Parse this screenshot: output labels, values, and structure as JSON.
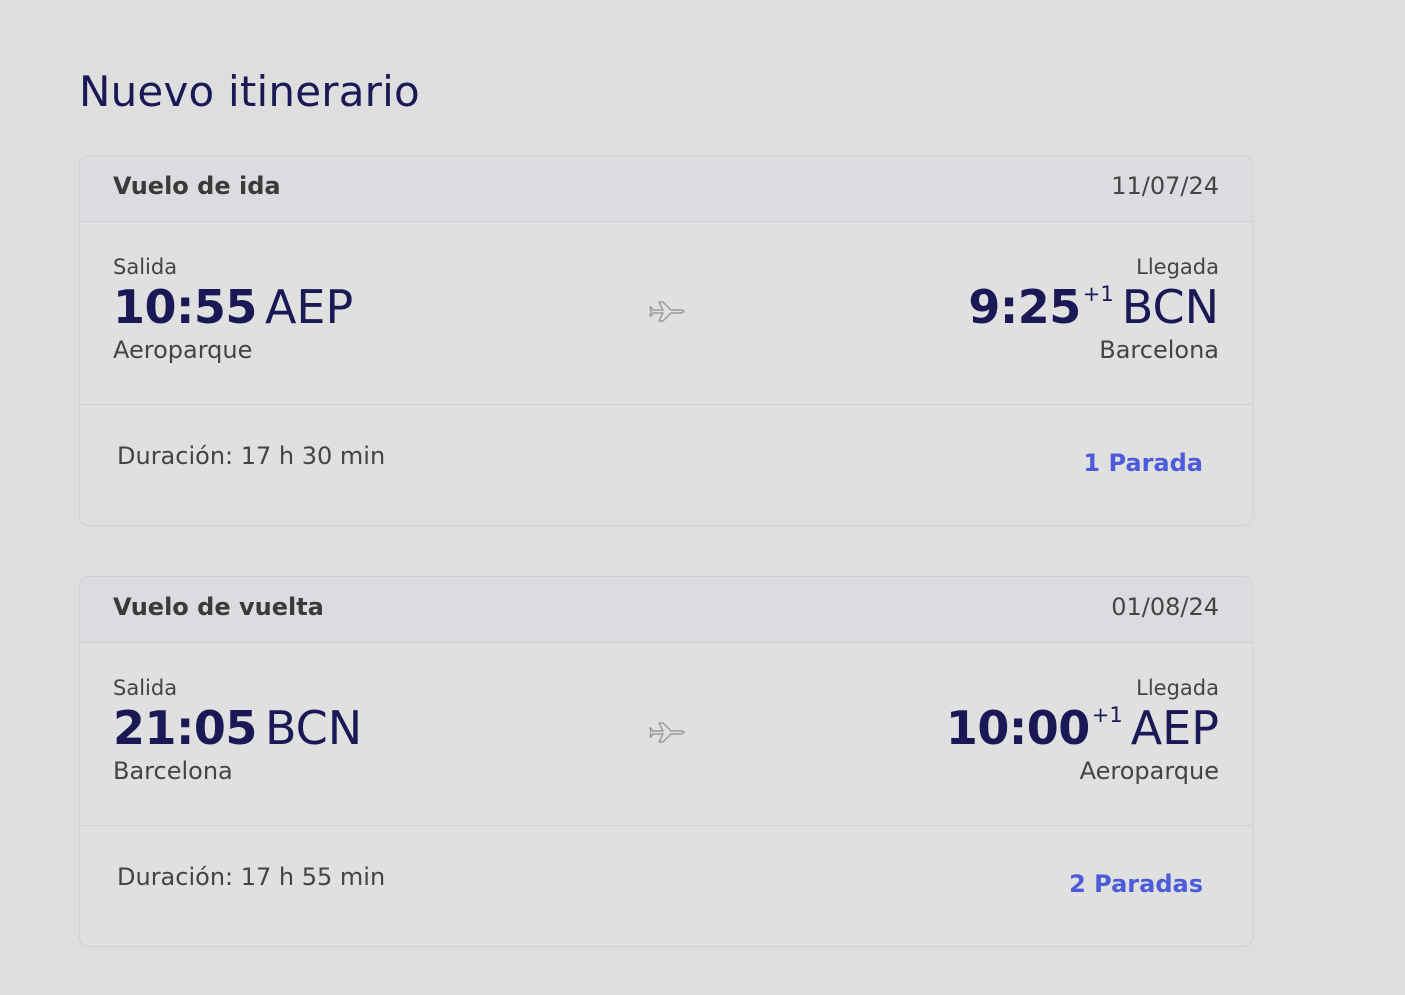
{
  "page_title": "Nuevo itinerario",
  "colors": {
    "background": "#dedede",
    "primary_text": "#1b1856",
    "link": "#4b5bd9"
  },
  "icons": [
    "airplane-icon"
  ],
  "legs": [
    {
      "title": "Vuelo de ida",
      "date": "11/07/24",
      "departure": {
        "label": "Salida",
        "time": "10:55",
        "code": "AEP",
        "city": "Aeroparque"
      },
      "arrival": {
        "label": "Llegada",
        "time": "9:25",
        "day_offset": "+1",
        "code": "BCN",
        "city": "Barcelona"
      },
      "duration": "Duración: 17 h 30 min",
      "stops": "1 Parada"
    },
    {
      "title": "Vuelo de vuelta",
      "date": "01/08/24",
      "departure": {
        "label": "Salida",
        "time": "21:05",
        "code": "BCN",
        "city": "Barcelona"
      },
      "arrival": {
        "label": "Llegada",
        "time": "10:00",
        "day_offset": "+1",
        "code": "AEP",
        "city": "Aeroparque"
      },
      "duration": "Duración: 17 h 55 min",
      "stops": "2 Paradas"
    }
  ]
}
